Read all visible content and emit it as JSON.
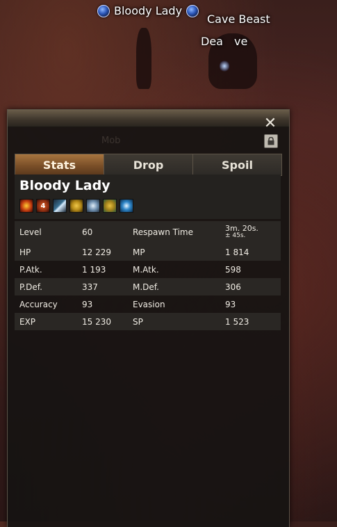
{
  "scene": {
    "nameplates": [
      {
        "name": "Bloody Lady"
      },
      {
        "name": "Cave Beast"
      },
      {
        "name": "Dea"
      },
      {
        "name": "ve"
      }
    ]
  },
  "panel": {
    "watermark": "Mob",
    "tabs": [
      {
        "label": "Stats",
        "active": true
      },
      {
        "label": "Drop",
        "active": false
      },
      {
        "label": "Spoil",
        "active": false
      }
    ],
    "mob_name": "Bloody Lady",
    "abilities": [
      {
        "icon": "ability-fire-icon",
        "label": "",
        "color": "#c23b10"
      },
      {
        "icon": "ability-level-4-icon",
        "label": "4",
        "color": "#8a2d12"
      },
      {
        "icon": "ability-sword-icon",
        "label": "",
        "color": "#3a6f8f"
      },
      {
        "icon": "ability-golden-beast-icon",
        "label": "",
        "color": "#b58a18"
      },
      {
        "icon": "ability-spiral-shield-icon",
        "label": "",
        "color": "#6e8eae"
      },
      {
        "icon": "ability-golden-armor-icon",
        "label": "",
        "color": "#a0801a"
      },
      {
        "icon": "ability-blue-vortex-icon",
        "label": "",
        "color": "#2e86c9"
      }
    ],
    "stats": [
      {
        "l1": "Level",
        "v1": "60",
        "l2": "Respawn Time",
        "v2": "3m. 20s.",
        "v2b": "± 45s."
      },
      {
        "l1": "HP",
        "v1": "12 229",
        "l2": "MP",
        "v2": "1 814"
      },
      {
        "l1": "P.Atk.",
        "v1": "1 193",
        "l2": "M.Atk.",
        "v2": "598"
      },
      {
        "l1": "P.Def.",
        "v1": "337",
        "l2": "M.Def.",
        "v2": "306"
      },
      {
        "l1": "Accuracy",
        "v1": "93",
        "l2": "Evasion",
        "v2": "93"
      },
      {
        "l1": "EXP",
        "v1": "15 230",
        "l2": "SP",
        "v2": "1 523"
      }
    ]
  }
}
